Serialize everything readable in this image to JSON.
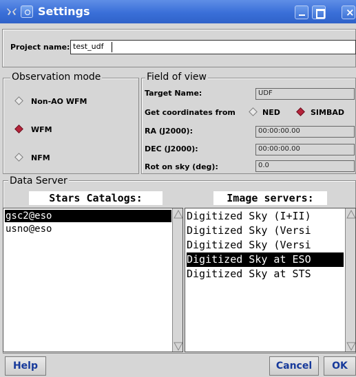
{
  "window": {
    "title": "Settings"
  },
  "project": {
    "label": "Project name:",
    "value": "test_udf"
  },
  "observation_mode": {
    "title": "Observation mode",
    "options": [
      {
        "label": "Non-AO WFM",
        "selected": false
      },
      {
        "label": "WFM",
        "selected": true
      },
      {
        "label": "NFM",
        "selected": false
      }
    ]
  },
  "field_of_view": {
    "title": "Field of view",
    "target_name": {
      "label": "Target Name:",
      "value": "UDF"
    },
    "coords_from": {
      "label": "Get coordinates from",
      "options": [
        {
          "label": "NED",
          "selected": false
        },
        {
          "label": "SIMBAD",
          "selected": true
        }
      ]
    },
    "ra": {
      "label": "RA (J2000):",
      "value": "00:00:00.00"
    },
    "dec": {
      "label": "DEC (J2000):",
      "value": "00:00:00.00"
    },
    "rot": {
      "label": "Rot on sky (deg):",
      "value": "0.0"
    }
  },
  "data_server": {
    "title": "Data Server",
    "stars_header": "Stars Catalogs:",
    "image_header": "Image servers:",
    "stars": [
      {
        "label": "gsc2@eso",
        "selected": true
      },
      {
        "label": "usno@eso",
        "selected": false
      }
    ],
    "images": [
      {
        "label": "Digitized Sky (I+II)",
        "selected": false
      },
      {
        "label": "Digitized Sky (Versi",
        "selected": false
      },
      {
        "label": "Digitized Sky (Versi",
        "selected": false
      },
      {
        "label": "Digitized Sky at ESO",
        "selected": true
      },
      {
        "label": "Digitized Sky at STS",
        "selected": false
      }
    ]
  },
  "buttons": {
    "help": "Help",
    "cancel": "Cancel",
    "ok": "OK"
  },
  "colors": {
    "titlebar": "#3a6fd8",
    "selection": "#000000",
    "radio_on": "#b6243a",
    "button_text": "#173a9b"
  },
  "icons": {
    "app": "tools-icon",
    "settings": "gear-icon",
    "minimize": "minimize-icon",
    "maximize": "maximize-icon",
    "close": "close-icon"
  }
}
